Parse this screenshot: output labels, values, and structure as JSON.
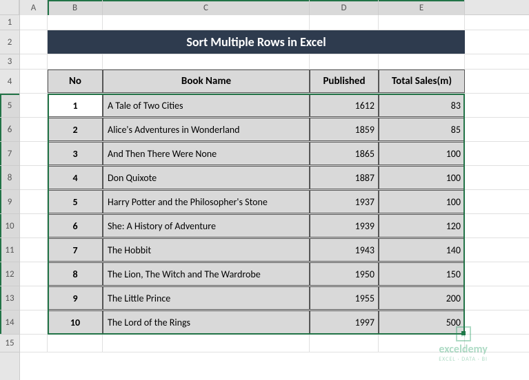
{
  "column_labels": [
    "A",
    "B",
    "C",
    "D",
    "E"
  ],
  "row_labels": [
    "1",
    "2",
    "3",
    "4",
    "5",
    "6",
    "7",
    "8",
    "9",
    "10",
    "11",
    "12",
    "13",
    "14",
    "15"
  ],
  "title": "Sort Multiple Rows in Excel",
  "headers": {
    "no": "No",
    "name": "Book Name",
    "published": "Published",
    "sales": "Total Sales(m)"
  },
  "rows": [
    {
      "no": 1,
      "name": "A Tale of Two Cities",
      "published": 1612,
      "sales": 83
    },
    {
      "no": 2,
      "name": "Alice's Adventures in Wonderland",
      "published": 1859,
      "sales": 85
    },
    {
      "no": 3,
      "name": "And Then There Were None",
      "published": 1865,
      "sales": 100
    },
    {
      "no": 4,
      "name": "Don Quixote",
      "published": 1887,
      "sales": 100
    },
    {
      "no": 5,
      "name": "Harry Potter and the Philosopher's Stone",
      "published": 1937,
      "sales": 100
    },
    {
      "no": 6,
      "name": "She: A History of Adventure",
      "published": 1939,
      "sales": 120
    },
    {
      "no": 7,
      "name": "The Hobbit",
      "published": 1943,
      "sales": 140
    },
    {
      "no": 8,
      "name": "The Lion, The Witch and The Wardrobe",
      "published": 1950,
      "sales": 150
    },
    {
      "no": 9,
      "name": "The Little Prince",
      "published": 1955,
      "sales": 200
    },
    {
      "no": 10,
      "name": "The Lord of the Rings",
      "published": 1997,
      "sales": 500
    }
  ],
  "watermark": {
    "brand": "exceldemy",
    "tagline": "EXCEL · DATA · BI"
  },
  "chart_data": {
    "type": "table",
    "title": "Sort Multiple Rows in Excel",
    "columns": [
      "No",
      "Book Name",
      "Published",
      "Total Sales(m)"
    ],
    "records": [
      [
        1,
        "A Tale of Two Cities",
        1612,
        83
      ],
      [
        2,
        "Alice's Adventures in Wonderland",
        1859,
        85
      ],
      [
        3,
        "And Then There Were None",
        1865,
        100
      ],
      [
        4,
        "Don Quixote",
        1887,
        100
      ],
      [
        5,
        "Harry Potter and the Philosopher's Stone",
        1937,
        100
      ],
      [
        6,
        "She: A History of Adventure",
        1939,
        120
      ],
      [
        7,
        "The Hobbit",
        1943,
        140
      ],
      [
        8,
        "The Lion, The Witch and The Wardrobe",
        1950,
        150
      ],
      [
        9,
        "The Little Prince",
        1955,
        200
      ],
      [
        10,
        "The Lord of the Rings",
        1997,
        500
      ]
    ]
  }
}
